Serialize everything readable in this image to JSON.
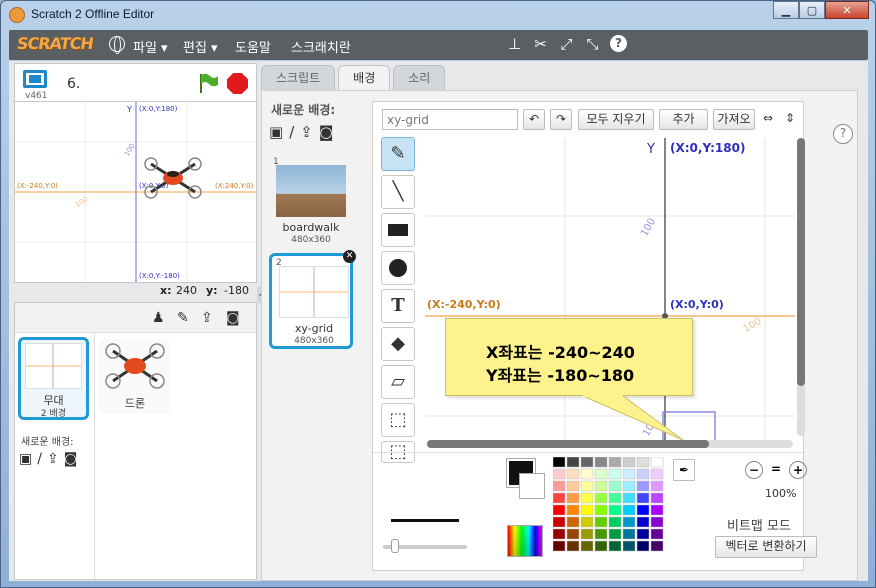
{
  "window": {
    "title": "Scratch 2 Offline Editor"
  },
  "menubar": {
    "logo": "SCRATCH",
    "items": [
      "파일",
      "편집",
      "도움말",
      "스크래치란"
    ],
    "tool_icons": [
      "stamp-icon",
      "cut-icon",
      "grow-icon",
      "shrink-icon",
      "help-icon"
    ]
  },
  "stage": {
    "version": "v461",
    "project_name": "6.",
    "x_label": "x:",
    "x_value": "240",
    "y_label": "y:",
    "y_value": "-180",
    "grid_labels": {
      "y_axis": "Y",
      "top": "(X:0,Y:180)",
      "left": "(X:-240,Y:0)",
      "center": "(X:0,Y:0)",
      "right": "(X:240,Y:0)",
      "bottom": "(X:0,Y:-180)",
      "tick": "100"
    }
  },
  "sprites": {
    "stage_thumb_label": "무대",
    "stage_thumb_count": "2 배경",
    "sprite_name": "드론",
    "new_backdrop_label": "새로운 배경:"
  },
  "tabs": [
    "스크립트",
    "배경",
    "소리"
  ],
  "backdrops": {
    "header": "새로운 배경:",
    "items": [
      {
        "num": "1",
        "name": "boardwalk",
        "size": "480x360"
      },
      {
        "num": "2",
        "name": "xy-grid",
        "size": "480x360"
      }
    ]
  },
  "paint": {
    "name_value": "xy-grid",
    "clear_label": "모두 지우기",
    "add_label": "추가",
    "import_label": "가져오기",
    "zoom": "100%",
    "mode_label": "비트맵 모드",
    "convert_label": "벡터로 변환하기",
    "grid_labels": {
      "y_axis": "Y",
      "top": "(X:0,Y:180)",
      "left": "(X:-240,Y:0)",
      "center": "(X:0,Y:0)",
      "tick": "100"
    },
    "callout_line1": "X좌표는 -240~240",
    "callout_line2": "Y좌표는 -180~180"
  },
  "colors": {
    "accent": "#1e9ad6",
    "menubar": "#5a5f64",
    "callout": "#fdf28b",
    "axis_orange": "#f0a04a",
    "axis_blue": "#2f2fbf"
  }
}
